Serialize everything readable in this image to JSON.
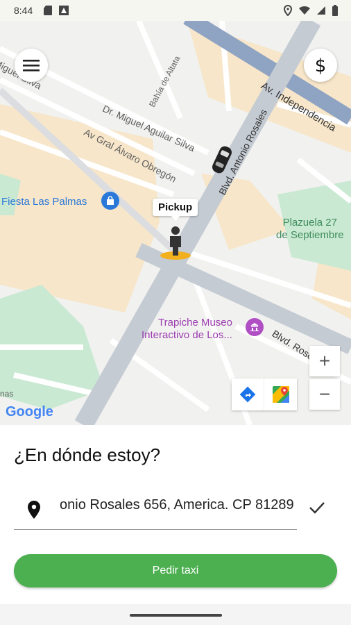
{
  "status_bar": {
    "time": "8:44"
  },
  "map": {
    "street_labels": [
      "Miguel Silva",
      "Dr. Miguel Aguilar Silva",
      "Av Gral Álvaro Obregón",
      "Bahía de Altata",
      "Av. Independencia",
      "Blvd. Antonio Rosales",
      "Blvd. Rosendo G.",
      "nas"
    ],
    "poi_label": "Fiesta Las Palmas",
    "park_label_line1": "Plazuela 27",
    "park_label_line2": "de Septiembre",
    "museum_label_line1": "Trapiche Museo",
    "museum_label_line2": "Interactivo de Los...",
    "pickup_label": "Pickup",
    "zoom_in": "+",
    "zoom_out": "−",
    "google_logo": "Google"
  },
  "sheet": {
    "title": "¿En dónde estoy?",
    "address_value": "onio Rosales 656, America. CP 81289",
    "request_button": "Pedir taxi"
  },
  "colors": {
    "accent": "#4caf50",
    "poi": "#2a78d8",
    "museum": "#9b3bb0"
  }
}
